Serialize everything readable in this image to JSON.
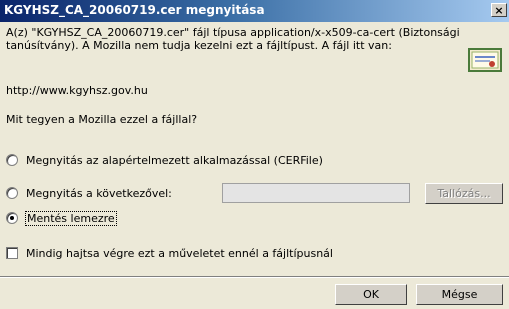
{
  "dialog": {
    "title": "KGYHSZ_CA_20060719.cer megnyitása",
    "close_glyph": "×",
    "description": "A(z) \"KGYHSZ_CA_20060719.cer\" fájl típusa application/x-x509-ca-cert (Biztonsági tanúsítvány). A Mozilla nem tudja kezelni ezt a fájltípust. A fájl itt van:",
    "source_url": "http://www.kgyhsz.gov.hu",
    "question": "Mit tegyen a Mozilla ezzel a fájllal?",
    "icon": "certificate-icon"
  },
  "options": {
    "open_default": "Megnyitás az alapértelmezett alkalmazással (CERFile)",
    "open_with": "Megnyitás a következővel:",
    "open_with_value": "",
    "browse_label": "Tallózás...",
    "save": "Mentés lemezre",
    "selected": "save"
  },
  "remember": {
    "label": "Mindig hajtsa végre ezt a műveletet ennél a fájltípusnál",
    "checked": false
  },
  "buttons": {
    "ok": "OK",
    "cancel": "Mégse"
  }
}
